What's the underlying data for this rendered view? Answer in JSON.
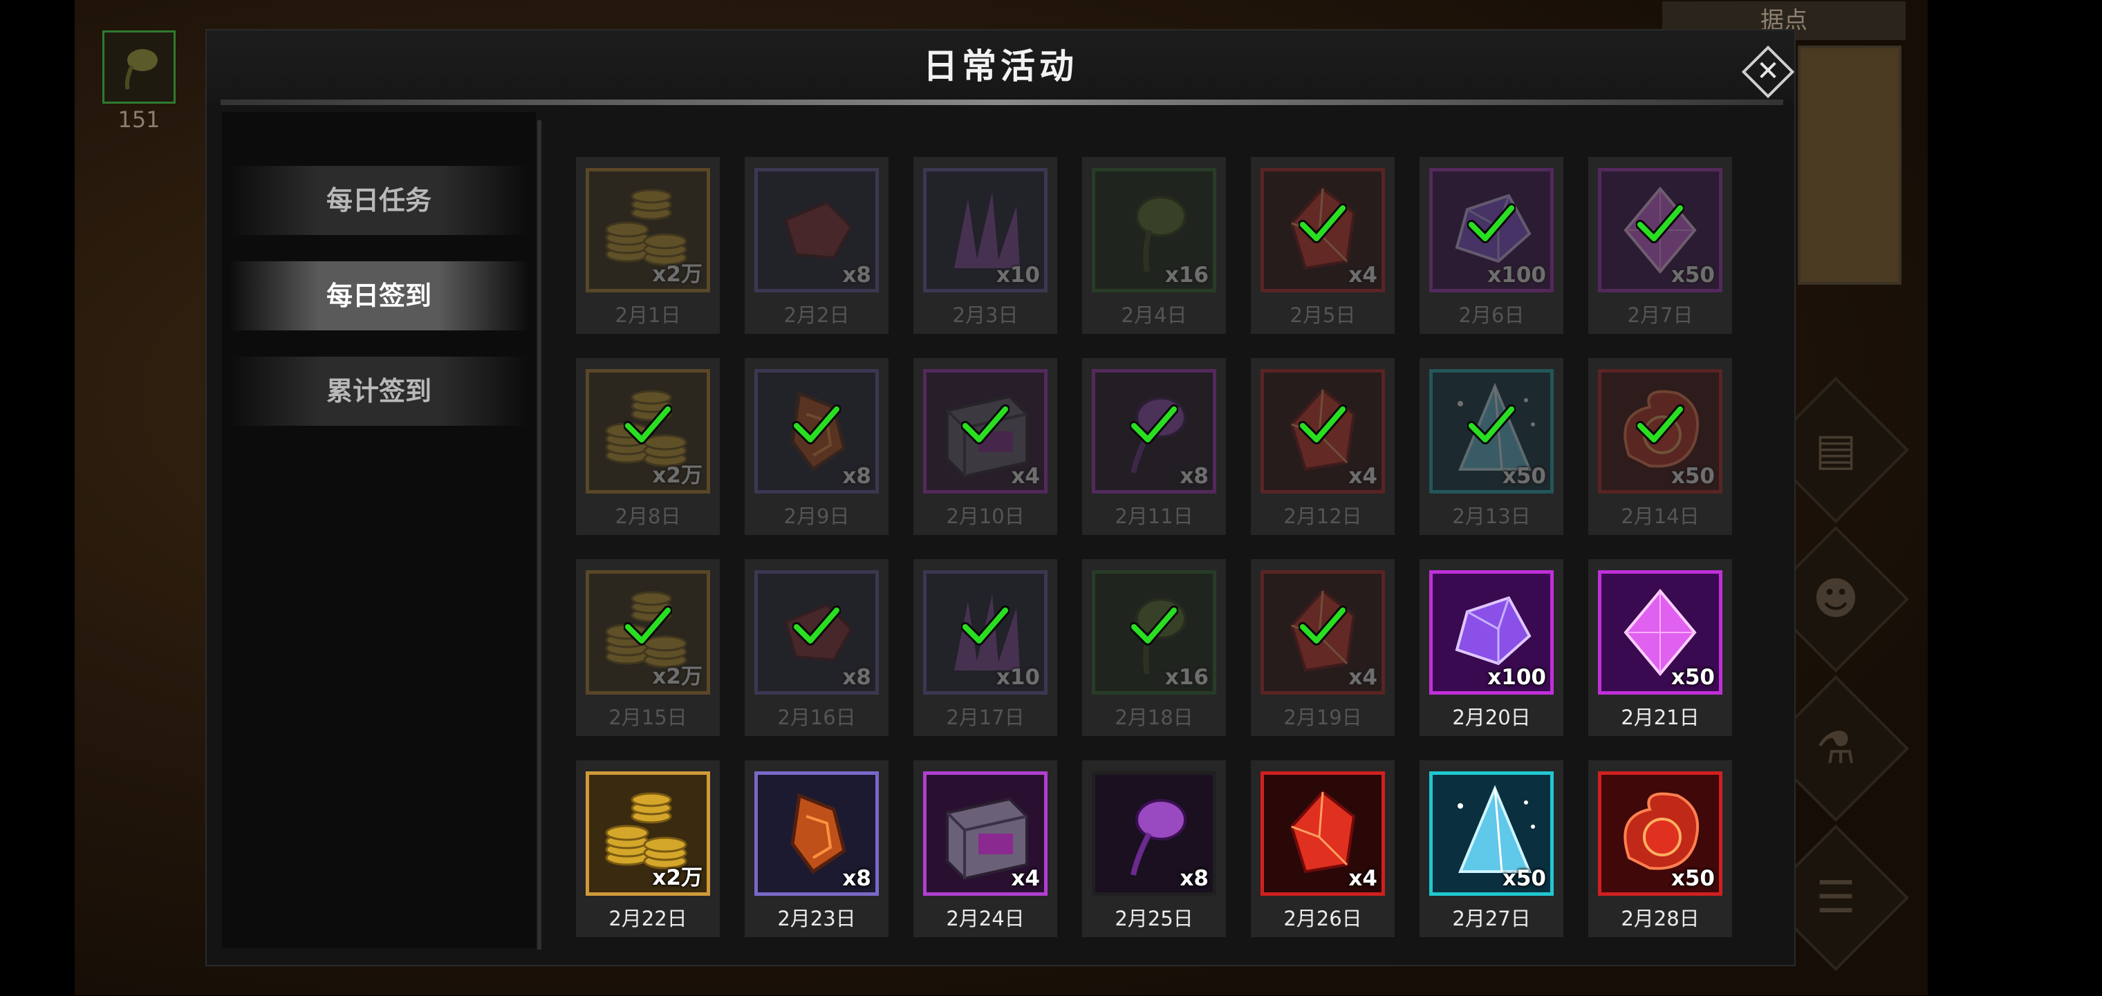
{
  "hud": {
    "item_count": "151",
    "map_tag": "据点"
  },
  "modal": {
    "title": "日常活动",
    "close_symbol": "✕"
  },
  "tabs": [
    {
      "label": "每日任务",
      "active": false
    },
    {
      "label": "每日签到",
      "active": true
    },
    {
      "label": "累计签到",
      "active": false
    }
  ],
  "checkin": [
    {
      "date": "2月1日",
      "qty": "x2万",
      "icon": "gold-coins-icon",
      "color": "#c08a2a",
      "state": "past"
    },
    {
      "date": "2月2日",
      "qty": "x8",
      "icon": "red-ore-icon",
      "color": "#6a5aa8",
      "state": "past"
    },
    {
      "date": "2月3日",
      "qty": "x10",
      "icon": "purple-claws-icon",
      "color": "#6a5aa8",
      "state": "past"
    },
    {
      "date": "2月4日",
      "qty": "x16",
      "icon": "green-bulb-icon",
      "color": "#2f6a2f",
      "state": "past"
    },
    {
      "date": "2月5日",
      "qty": "x4",
      "icon": "red-crystal-icon",
      "color": "#c02020",
      "state": "claimed"
    },
    {
      "date": "2月6日",
      "qty": "x100",
      "icon": "purple-gem-icon",
      "color": "#b030c8",
      "state": "claimed"
    },
    {
      "date": "2月7日",
      "qty": "x50",
      "icon": "pink-diamond-icon",
      "color": "#b030c8",
      "state": "claimed"
    },
    {
      "date": "2月8日",
      "qty": "x2万",
      "icon": "gold-coins-icon",
      "color": "#c08a2a",
      "state": "claimed"
    },
    {
      "date": "2月9日",
      "qty": "x8",
      "icon": "orange-ore-icon",
      "color": "#6a5aa8",
      "state": "claimed"
    },
    {
      "date": "2月10日",
      "qty": "x4",
      "icon": "spellbook-icon",
      "color": "#b030c8",
      "state": "claimed"
    },
    {
      "date": "2月11日",
      "qty": "x8",
      "icon": "purple-bulb-icon",
      "color": "#b030c8",
      "state": "claimed"
    },
    {
      "date": "2月12日",
      "qty": "x4",
      "icon": "red-crystal-icon",
      "color": "#c02020",
      "state": "claimed"
    },
    {
      "date": "2月13日",
      "qty": "x50",
      "icon": "blue-pyramid-icon",
      "color": "#20b8c0",
      "state": "claimed"
    },
    {
      "date": "2月14日",
      "qty": "x50",
      "icon": "fire-orb-icon",
      "color": "#c02020",
      "state": "claimed"
    },
    {
      "date": "2月15日",
      "qty": "x2万",
      "icon": "gold-coins-icon",
      "color": "#c08a2a",
      "state": "claimed"
    },
    {
      "date": "2月16日",
      "qty": "x8",
      "icon": "red-ore-icon",
      "color": "#6a5aa8",
      "state": "claimed"
    },
    {
      "date": "2月17日",
      "qty": "x10",
      "icon": "purple-claws-icon",
      "color": "#6a5aa8",
      "state": "claimed"
    },
    {
      "date": "2月18日",
      "qty": "x16",
      "icon": "green-bulb-icon",
      "color": "#2f6a2f",
      "state": "claimed"
    },
    {
      "date": "2月19日",
      "qty": "x4",
      "icon": "red-crystal-icon",
      "color": "#c02020",
      "state": "claimed"
    },
    {
      "date": "2月20日",
      "qty": "x100",
      "icon": "purple-gem-icon",
      "color": "#c030d8",
      "state": "available"
    },
    {
      "date": "2月21日",
      "qty": "x50",
      "icon": "pink-diamond-icon",
      "color": "#c030d8",
      "state": "available"
    },
    {
      "date": "2月22日",
      "qty": "x2万",
      "icon": "gold-coins-icon",
      "color": "#d09a3a",
      "state": "available"
    },
    {
      "date": "2月23日",
      "qty": "x8",
      "icon": "orange-ore-icon",
      "color": "#7a68c8",
      "state": "available"
    },
    {
      "date": "2月24日",
      "qty": "x4",
      "icon": "spellbook-icon",
      "color": "#b040d0",
      "state": "available"
    },
    {
      "date": "2月25日",
      "qty": "x8",
      "icon": "purple-bulb-icon",
      "color": "#202020",
      "state": "available"
    },
    {
      "date": "2月26日",
      "qty": "x4",
      "icon": "red-crystal-icon",
      "color": "#d02020",
      "state": "available"
    },
    {
      "date": "2月27日",
      "qty": "x50",
      "icon": "blue-pyramid-icon",
      "color": "#20c8d0",
      "state": "available"
    },
    {
      "date": "2月28日",
      "qty": "x50",
      "icon": "fire-orb-icon",
      "color": "#d02020",
      "state": "available"
    }
  ]
}
